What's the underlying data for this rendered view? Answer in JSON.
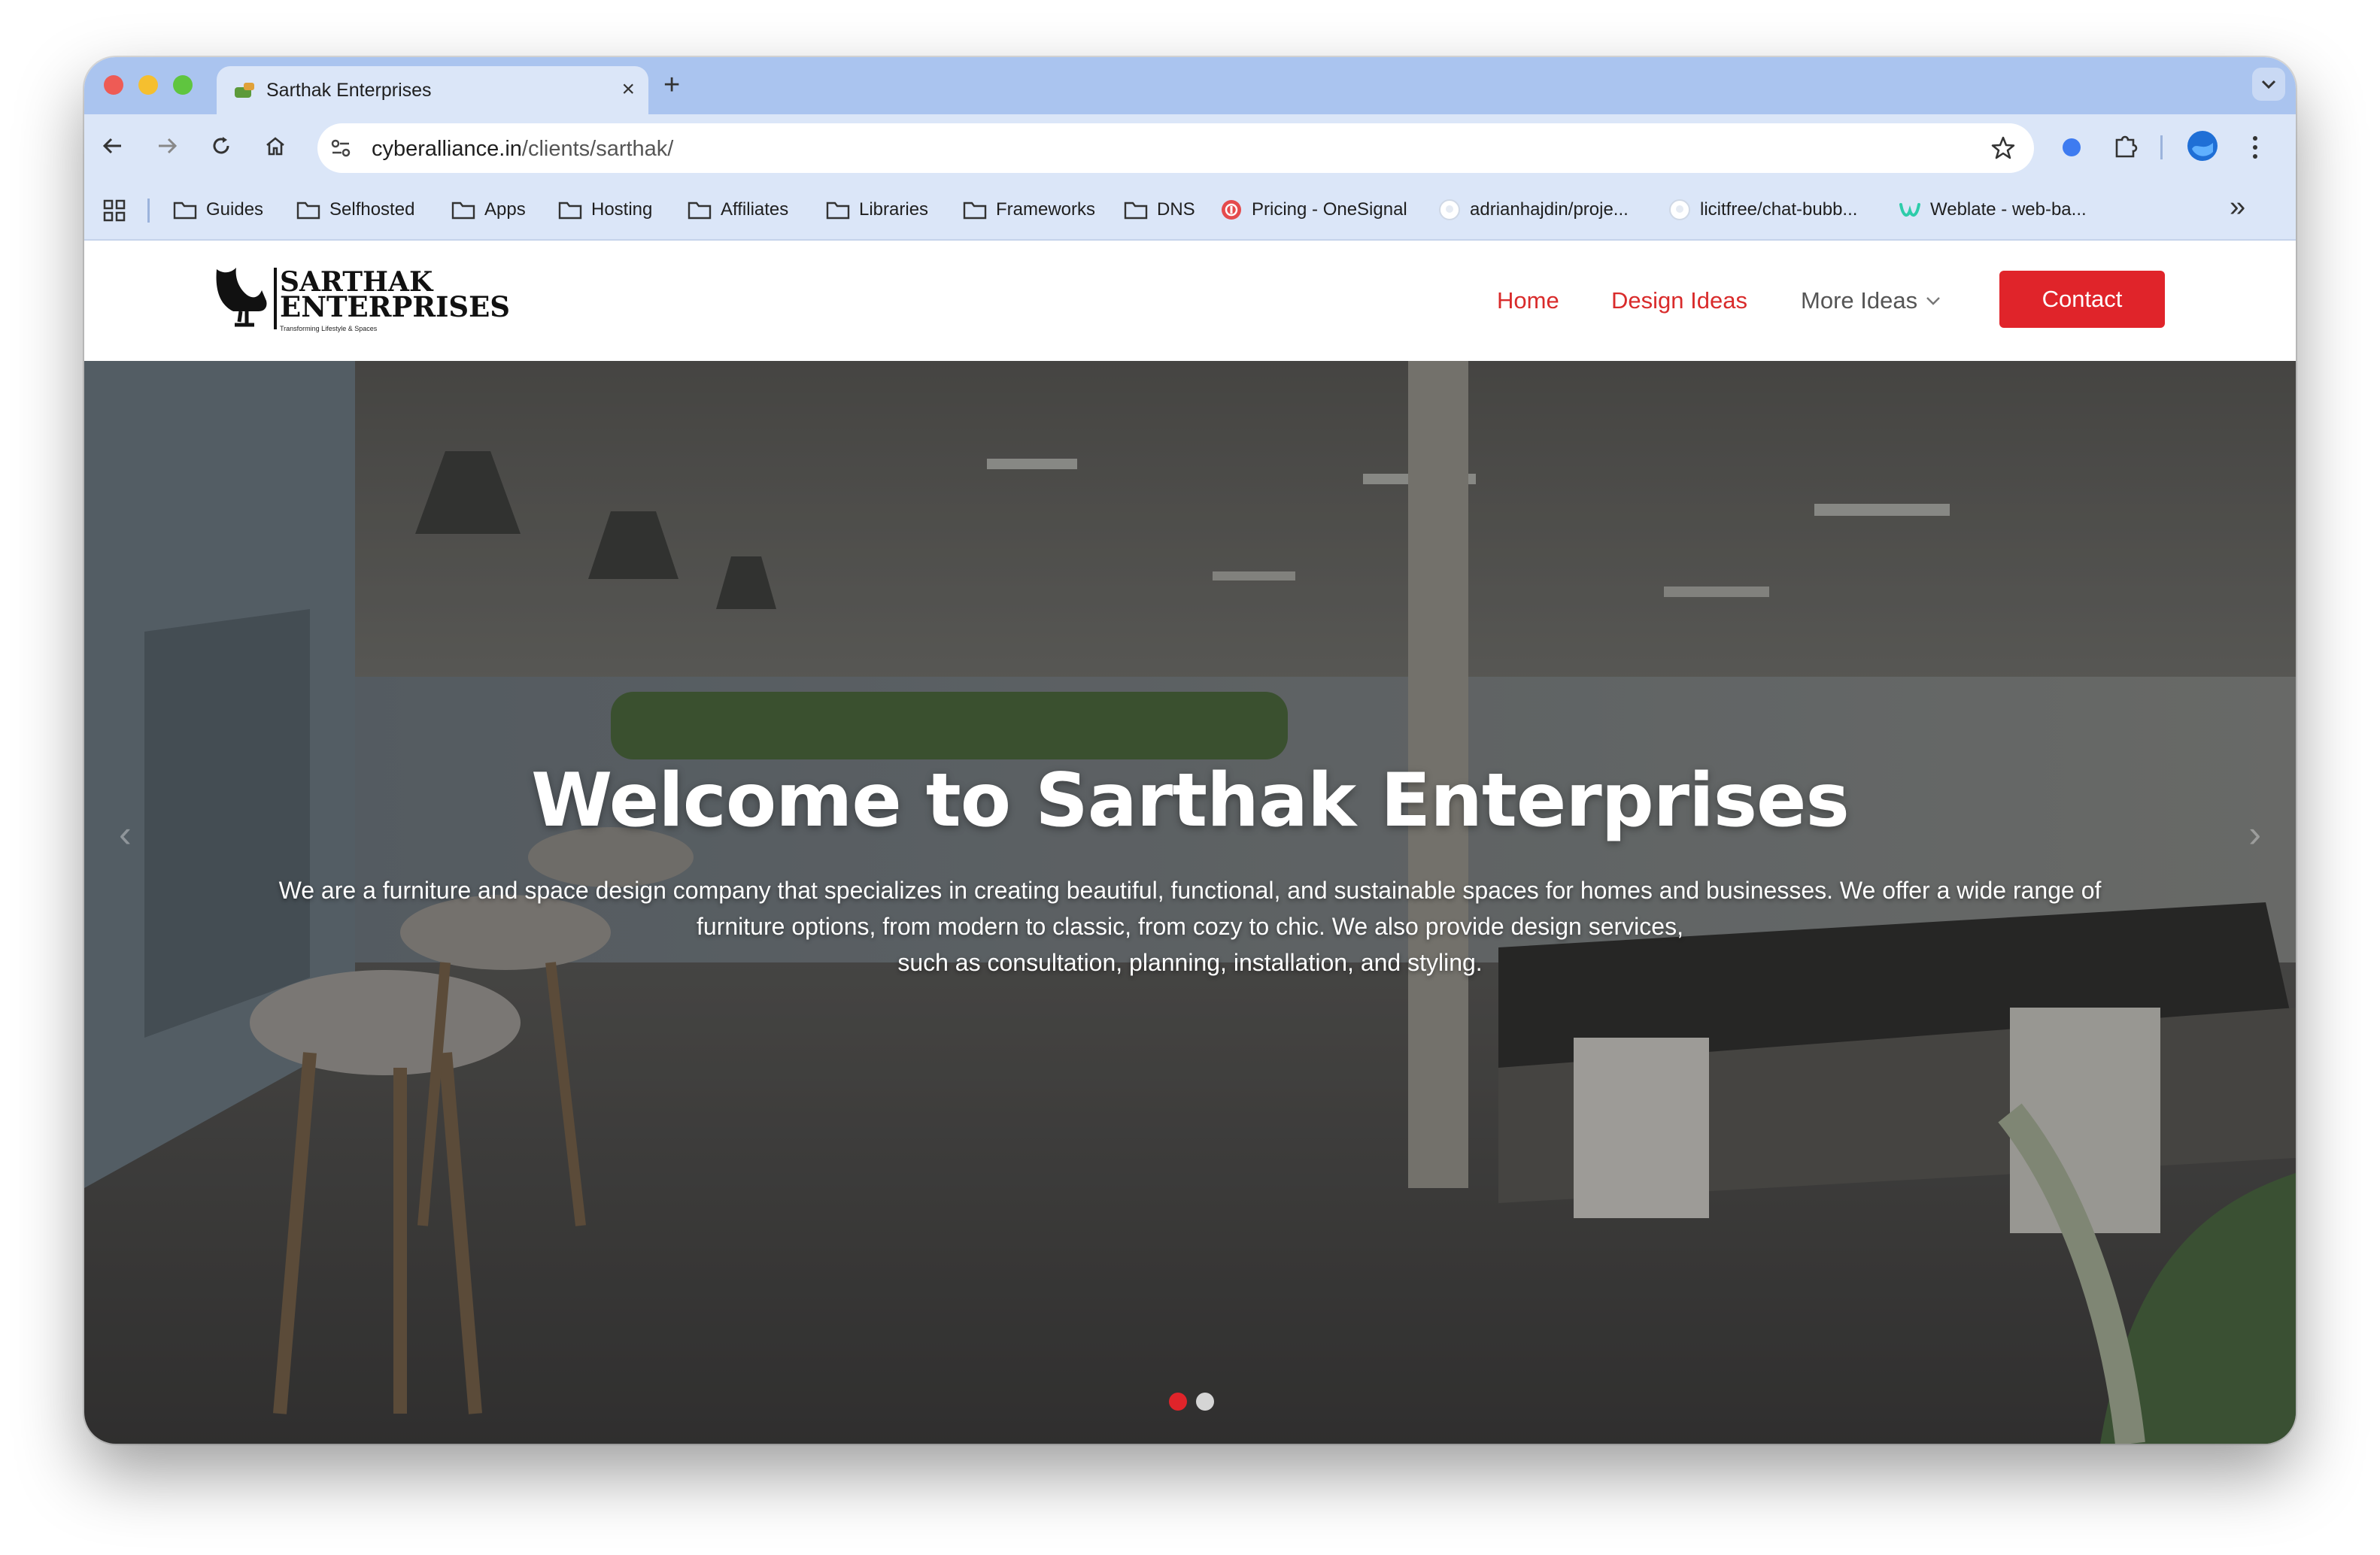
{
  "browser": {
    "tab_title": "Sarthak Enterprises",
    "new_tab_symbol": "+",
    "close_symbol": "×",
    "url_host": "cyberalliance.in",
    "url_path": "/clients/sarthak/",
    "bookmarks": [
      {
        "label": "Guides",
        "icon": "folder-icon"
      },
      {
        "label": "Selfhosted",
        "icon": "folder-icon"
      },
      {
        "label": "Apps",
        "icon": "folder-icon"
      },
      {
        "label": "Hosting",
        "icon": "folder-icon"
      },
      {
        "label": "Affiliates",
        "icon": "folder-icon"
      },
      {
        "label": "Libraries",
        "icon": "folder-icon"
      },
      {
        "label": "Frameworks",
        "icon": "folder-icon"
      },
      {
        "label": "DNS",
        "icon": "folder-icon"
      },
      {
        "label": "Pricing - OneSignal",
        "icon": "onesignal-icon"
      },
      {
        "label": "adrianhajdin/proje...",
        "icon": "github-icon"
      },
      {
        "label": "licitfree/chat-bubb...",
        "icon": "github-icon"
      },
      {
        "label": "Weblate - web-ba...",
        "icon": "weblate-icon"
      }
    ],
    "overflow_symbol": "»"
  },
  "site": {
    "logo": {
      "line1": "SARTHAK",
      "line2": "ENTERPRISES",
      "tagline": "Transforming Lifestyle & Spaces"
    },
    "nav": {
      "home": "Home",
      "design_ideas": "Design Ideas",
      "more_ideas": "More Ideas",
      "contact": "Contact"
    },
    "hero": {
      "title": "Welcome to Sarthak Enterprises",
      "line1": "We are a furniture and space design company that specializes in creating beautiful, functional, and sustainable spaces for homes and businesses. We offer a wide range of",
      "line2": "furniture options, from modern to classic, from cozy to chic. We also provide design services,",
      "line3": "such as consultation, planning, installation, and styling.",
      "prev_symbol": "‹",
      "next_symbol": "›",
      "slide_count": 2,
      "active_slide": 1
    }
  },
  "colors": {
    "accent": "#e0242a",
    "tabstrip": "#aac4ef",
    "toolbar": "#dbe6f8"
  }
}
